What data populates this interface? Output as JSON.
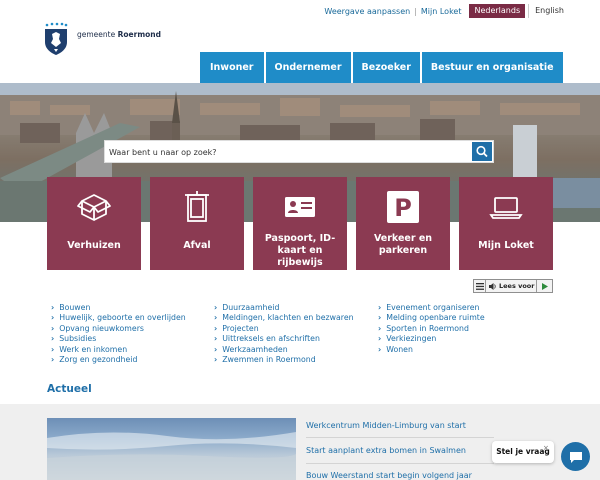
{
  "utility": {
    "weergave": "Weergave aanpassen",
    "mijn_loket": "Mijn Loket",
    "lang_nl": "Nederlands",
    "lang_en": "English"
  },
  "logo": {
    "prefix": "gemeente",
    "name": "Roermond"
  },
  "nav": [
    "Inwoner",
    "Ondernemer",
    "Bezoeker",
    "Bestuur en organisatie"
  ],
  "search": {
    "placeholder": "Waar bent u naar op zoek?",
    "icon": "search-icon"
  },
  "tiles": [
    {
      "label": "Verhuizen",
      "icon": "box-icon"
    },
    {
      "label": "Afval",
      "icon": "waste-container-icon"
    },
    {
      "label": "Paspoort, ID-kaart en rijbewijs",
      "icon": "id-card-icon"
    },
    {
      "label": "Verkeer en parkeren",
      "icon": "parking-icon"
    },
    {
      "label": "Mijn Loket",
      "icon": "laptop-icon"
    }
  ],
  "lees_voor": "Lees voor",
  "links": {
    "col1": [
      "Bouwen",
      "Huwelijk, geboorte en overlijden",
      "Opvang nieuwkomers",
      "Subsidies",
      "Werk en inkomen",
      "Zorg en gezondheid"
    ],
    "col2": [
      "Duurzaamheid",
      "Meldingen, klachten en bezwaren",
      "Projecten",
      "Uittreksels en afschriften",
      "Werkzaamheden",
      "Zwemmen in Roermond"
    ],
    "col3": [
      "Evenement organiseren",
      "Melding openbare ruimte",
      "Sporten in Roermond",
      "Verkiezingen",
      "Wonen"
    ]
  },
  "actueel": {
    "heading": "Actueel",
    "items": [
      "Werkcentrum Midden-Limburg van start",
      "Start aanplant extra bomen in Swalmen",
      "Bouw Weerstand start begin volgend jaar"
    ]
  },
  "chat": {
    "label": "Stel je vraag",
    "close": "×"
  },
  "colors": {
    "brand_blue": "#1f8cc8",
    "tile_maroon": "#8b3a52",
    "link_blue": "#1f6fa8"
  }
}
